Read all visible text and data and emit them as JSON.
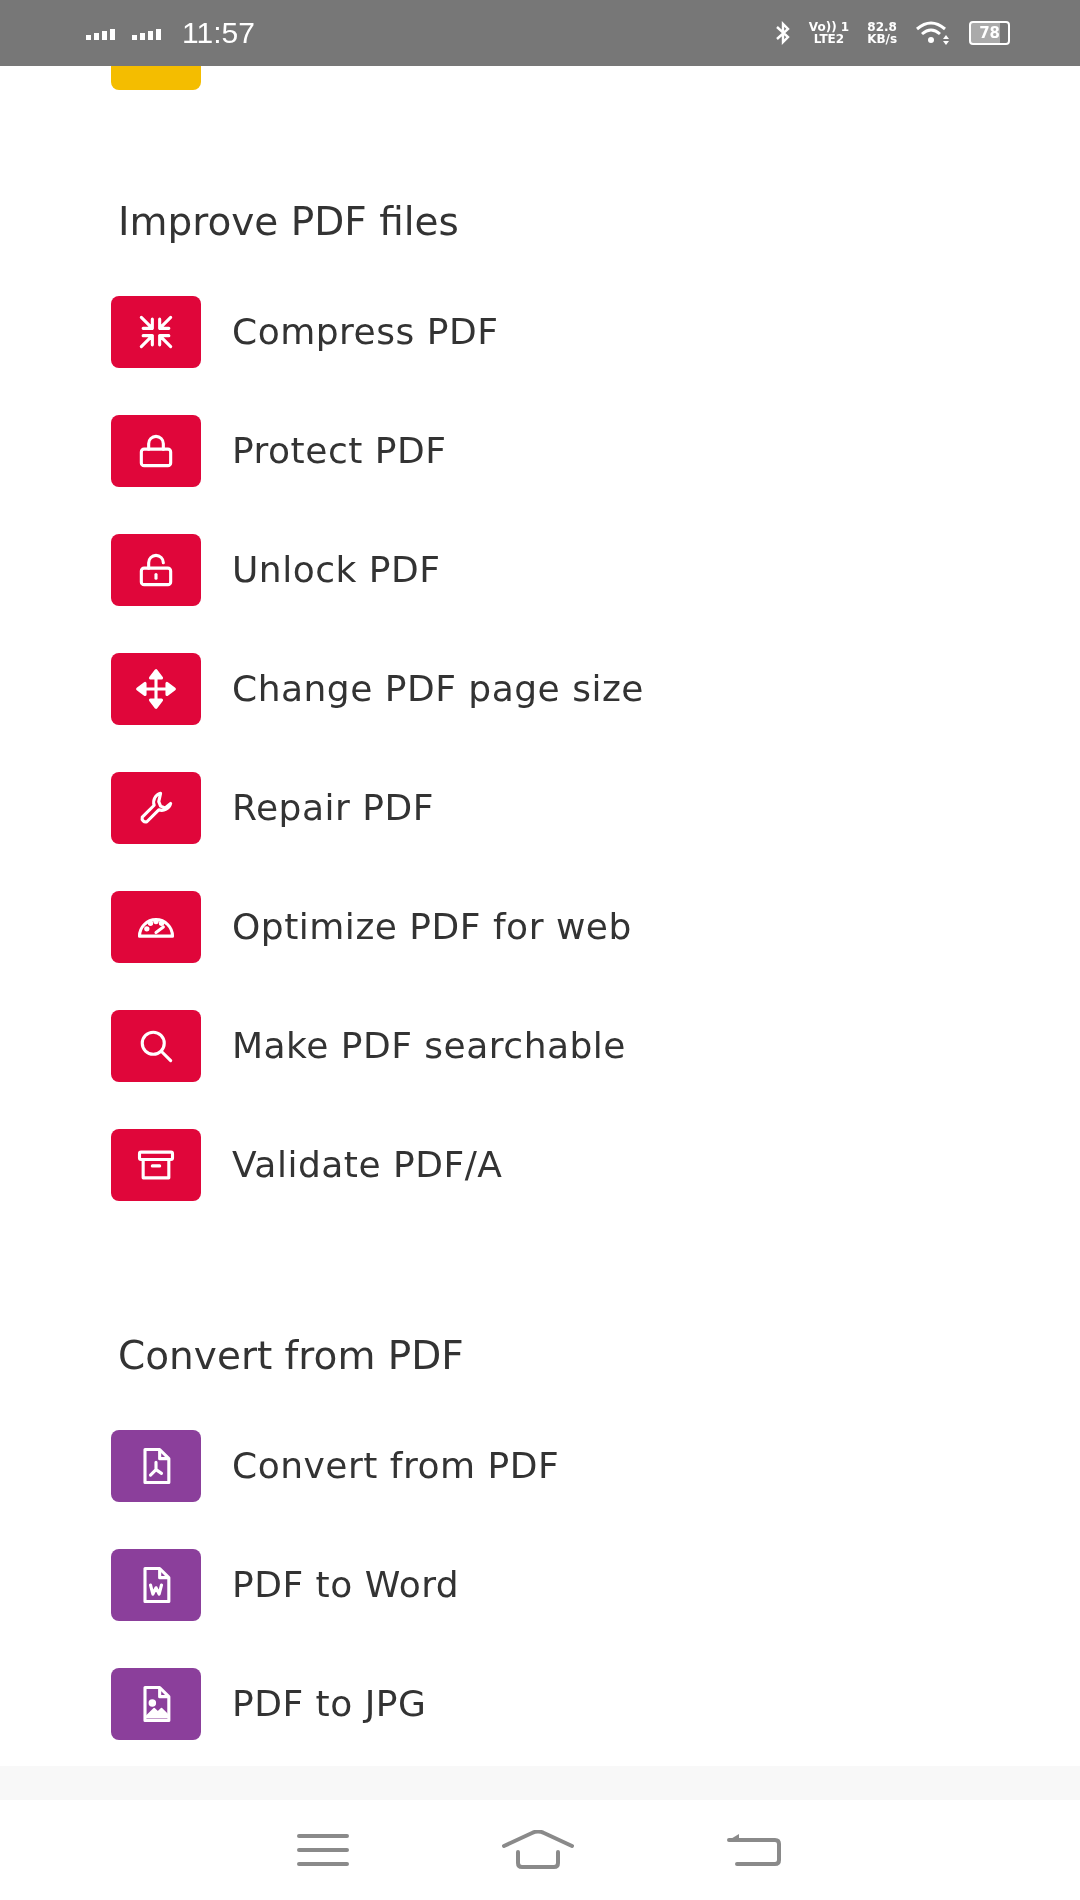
{
  "status_bar": {
    "time": "11:57",
    "volte": "Vo)) 1",
    "lte": "LTE2",
    "speed": "82.8",
    "speed_unit": "KB/s",
    "battery": "78"
  },
  "sections": [
    {
      "title": "Improve PDF files",
      "color": "#e0063a",
      "items": [
        {
          "label": "Compress PDF",
          "kind": "compress"
        },
        {
          "label": "Protect PDF",
          "kind": "lock"
        },
        {
          "label": "Unlock PDF",
          "kind": "unlock"
        },
        {
          "label": "Change PDF page size",
          "kind": "move"
        },
        {
          "label": "Repair PDF",
          "kind": "wrench"
        },
        {
          "label": "Optimize PDF for web",
          "kind": "gauge"
        },
        {
          "label": "Make PDF searchable",
          "kind": "search"
        },
        {
          "label": "Validate PDF/A",
          "kind": "archive"
        }
      ]
    },
    {
      "title": "Convert from PDF",
      "color": "#8b3f9b",
      "items": [
        {
          "label": "Convert from PDF",
          "kind": "file-pdf"
        },
        {
          "label": "PDF to Word",
          "kind": "file-word"
        },
        {
          "label": "PDF to JPG",
          "kind": "file-image"
        }
      ]
    }
  ]
}
